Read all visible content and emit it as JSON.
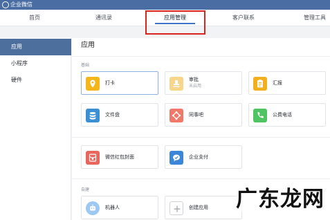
{
  "window": {
    "title": "企业微信"
  },
  "nav": {
    "tabs": [
      "首页",
      "通讯录",
      "应用管理",
      "客户联系",
      "管理工具"
    ]
  },
  "sidebar": {
    "items": [
      "应用",
      "小程序",
      "硬件"
    ]
  },
  "main": {
    "title": "应用",
    "sections": {
      "basic": "基础",
      "custom": "自建"
    },
    "apps": {
      "daka": "打卡",
      "shenpi": "审批",
      "shenpi_status": "未启用",
      "huibao": "汇报",
      "wenjianpan": "文件盘",
      "tongshiba": "同事吧",
      "gongfei": "公费电话",
      "hongbao": "微信红包封面",
      "zhifu": "企业支付",
      "robot": "机器人",
      "create": "创建应用"
    }
  },
  "watermark": "广东龙网",
  "colors": {
    "header_bg": "#4a6ea3",
    "sidebar_active_bg": "#4d6f9d",
    "active_tab_underline": "#3c73c8",
    "highlight_border": "#d8231f",
    "icon_daka": "#f4b61a",
    "icon_shenpi": "#f7d58a",
    "icon_huibao": "#f2b01e",
    "icon_wenjianpan": "#3b8fd3",
    "icon_tongshiba": "#f07a6a",
    "icon_gongfei": "#4fc465",
    "icon_hongbao": "#e8665b",
    "icon_zhifu": "#3b86d9",
    "icon_robot": "#9cc8f2"
  }
}
